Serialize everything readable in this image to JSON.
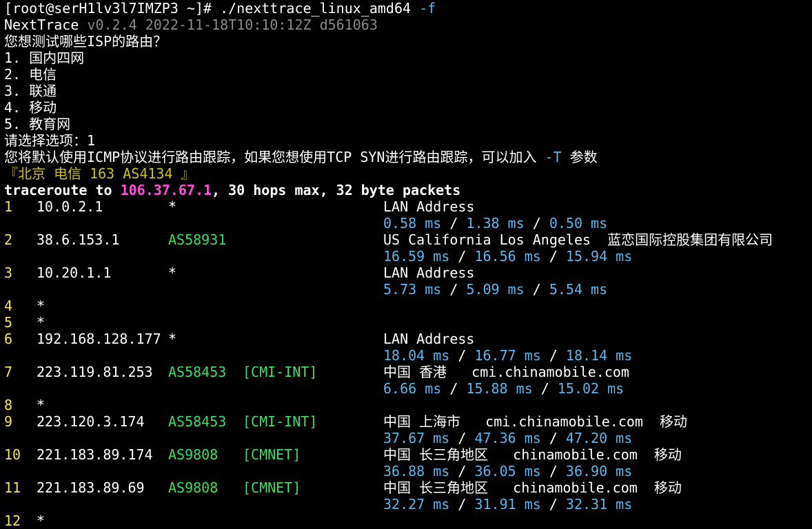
{
  "prompt": {
    "prefix": "[root@serH1lv3l7IMZP3 ~]# ",
    "command": "./nexttrace_linux_amd64",
    "flag": "-f"
  },
  "banner": {
    "name": "NextTrace",
    "version": "v0.2.4 2022-11-18T10:10:12Z d561063"
  },
  "menu": {
    "question": "您想测试哪些ISP的路由？",
    "options": [
      "1. 国内四网",
      "2. 电信",
      "3. 联通",
      "4. 移动",
      "5. 教育网"
    ],
    "answer": "请选择选项：1"
  },
  "notice": {
    "text_a": "您将默认使用ICMP协议进行路由跟踪，如果您想使用TCP SYN进行路由跟踪，可以加入 ",
    "flag": "-T",
    "text_b": " 参数"
  },
  "target_label": "『北京 电信 163 AS4134 』",
  "traceroute": {
    "prefix": "traceroute to ",
    "ip": "106.37.67.1",
    "suffix": ", 30 hops max, 32 byte packets"
  },
  "hops": [
    {
      "n": "1",
      "ip": "10.0.2.1",
      "as": "*",
      "tag": "",
      "loc": "LAN Address",
      "lat": [
        "0.58 ms",
        "1.38 ms",
        "0.50 ms"
      ]
    },
    {
      "n": "2",
      "ip": "38.6.153.1",
      "as": "AS58931",
      "tag": "",
      "loc": "US California Los Angeles  蓝恋国际控股集团有限公司",
      "lat": [
        "16.59 ms",
        "16.56 ms",
        "15.94 ms"
      ]
    },
    {
      "n": "3",
      "ip": "10.20.1.1",
      "as": "*",
      "tag": "",
      "loc": "LAN Address",
      "lat": [
        "5.73 ms",
        "5.09 ms",
        "5.54 ms"
      ]
    },
    {
      "n": "4",
      "ip": "*",
      "as": "",
      "tag": "",
      "loc": "",
      "lat": []
    },
    {
      "n": "5",
      "ip": "*",
      "as": "",
      "tag": "",
      "loc": "",
      "lat": []
    },
    {
      "n": "6",
      "ip": "192.168.128.177",
      "as": "*",
      "tag": "",
      "loc": "LAN Address",
      "lat": [
        "18.04 ms",
        "16.77 ms",
        "18.14 ms"
      ]
    },
    {
      "n": "7",
      "ip": "223.119.81.253",
      "as": "AS58453",
      "tag": "[CMI-INT]",
      "loc": "中国 香港   cmi.chinamobile.com",
      "lat": [
        "6.66 ms",
        "15.88 ms",
        "15.02 ms"
      ]
    },
    {
      "n": "8",
      "ip": "*",
      "as": "",
      "tag": "",
      "loc": "",
      "lat": []
    },
    {
      "n": "9",
      "ip": "223.120.3.174",
      "as": "AS58453",
      "tag": "[CMI-INT]",
      "loc": "中国 上海市   cmi.chinamobile.com  移动",
      "lat": [
        "37.67 ms",
        "47.36 ms",
        "47.20 ms"
      ]
    },
    {
      "n": "10",
      "ip": "221.183.89.174",
      "as": "AS9808",
      "tag": "[CMNET]",
      "loc": "中国 长三角地区   chinamobile.com  移动",
      "lat": [
        "36.88 ms",
        "36.05 ms",
        "36.90 ms"
      ]
    },
    {
      "n": "11",
      "ip": "221.183.89.69",
      "as": "AS9808",
      "tag": "[CMNET]",
      "loc": "中国 长三角地区   chinamobile.com  移动",
      "lat": [
        "32.27 ms",
        "31.91 ms",
        "32.31 ms"
      ]
    },
    {
      "n": "12",
      "ip": "*",
      "as": "",
      "tag": "",
      "loc": "",
      "lat": []
    }
  ],
  "colors": {
    "background": "#000000",
    "foreground": "#ffffff",
    "hop_number": "#f2e45a",
    "asn": "#3ddc6b",
    "latency": "#5fb7e8",
    "target_ip": "#ff4fd8",
    "target_label": "#c9c22a",
    "dim": "#8a8a8a"
  }
}
